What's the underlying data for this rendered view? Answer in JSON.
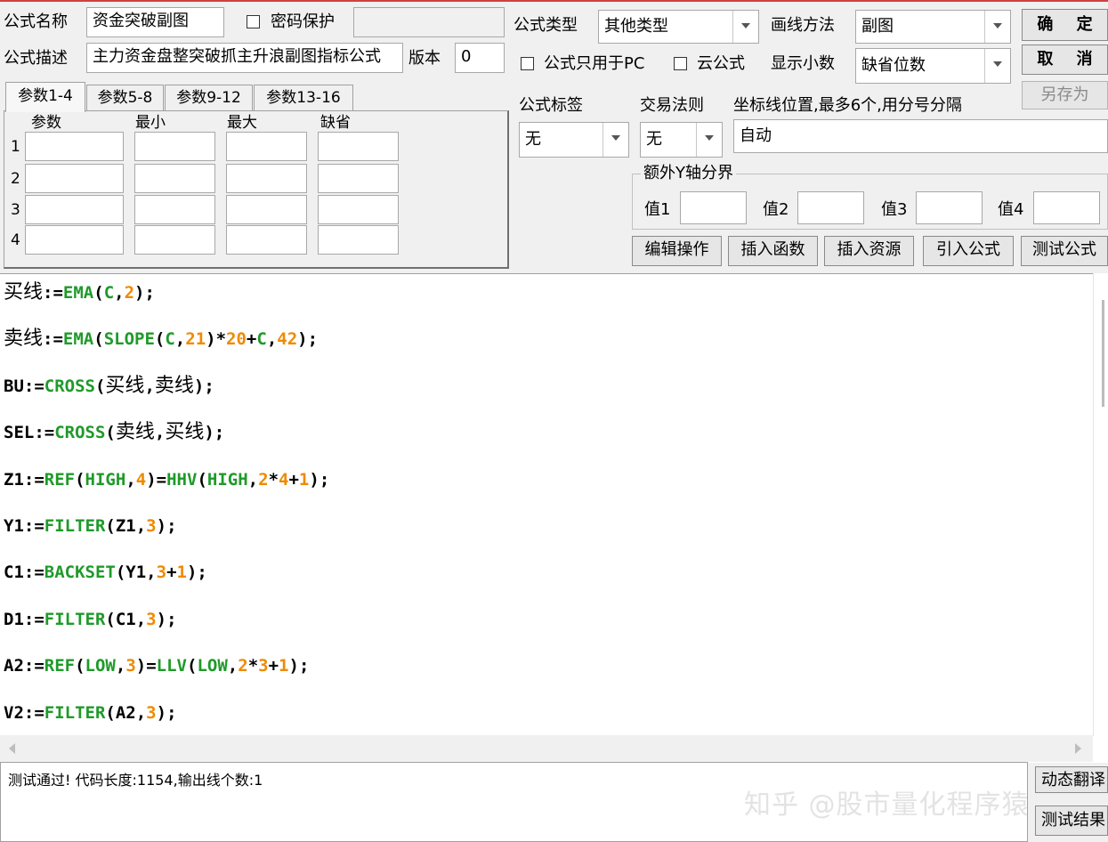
{
  "form": {
    "name_label": "公式名称",
    "name_value": "资金突破副图",
    "password_label": "密码保护",
    "password_value": "",
    "desc_label": "公式描述",
    "desc_value": "主力资金盘整突破抓主升浪副图指标公式",
    "version_label": "版本",
    "version_value": "0",
    "type_label": "公式类型",
    "type_value": "其他类型",
    "draw_label": "画线方法",
    "draw_value": "副图",
    "pc_only_label": "公式只用于PC",
    "cloud_label": "云公式",
    "decimal_label": "显示小数",
    "decimal_value": "缺省位数"
  },
  "buttons": {
    "ok": "确 定",
    "cancel": "取 消",
    "save_as": "另存为"
  },
  "tabs": [
    "参数1-4",
    "参数5-8",
    "参数9-12",
    "参数13-16"
  ],
  "params": {
    "headers": [
      "参数",
      "最小",
      "最大",
      "缺省"
    ],
    "rows": [
      "1",
      "2",
      "3",
      "4"
    ]
  },
  "tag": {
    "label": "公式标签",
    "value": "无"
  },
  "trade_rule": {
    "label": "交易法则",
    "value": "无"
  },
  "coord": {
    "label": "坐标线位置,最多6个,用分号分隔",
    "value": "自动"
  },
  "yaxis": {
    "title": "额外Y轴分界",
    "labels": [
      "值1",
      "值2",
      "值3",
      "值4"
    ]
  },
  "action_buttons": [
    "编辑操作",
    "插入函数",
    "插入资源",
    "引入公式",
    "测试公式"
  ],
  "code": [
    [
      [
        "cn",
        "买线"
      ],
      [
        "t",
        ":="
      ],
      [
        "f",
        "EMA"
      ],
      [
        "t",
        "("
      ],
      [
        "f",
        "C"
      ],
      [
        "t",
        ","
      ],
      [
        "n",
        "2"
      ],
      [
        "t",
        ");"
      ]
    ],
    [
      [
        "cn",
        "卖线"
      ],
      [
        "t",
        ":="
      ],
      [
        "f",
        "EMA"
      ],
      [
        "t",
        "("
      ],
      [
        "f",
        "SLOPE"
      ],
      [
        "t",
        "("
      ],
      [
        "f",
        "C"
      ],
      [
        "t",
        ","
      ],
      [
        "n",
        "21"
      ],
      [
        "t",
        ")*"
      ],
      [
        "n",
        "20"
      ],
      [
        "t",
        "+"
      ],
      [
        "f",
        "C"
      ],
      [
        "t",
        ","
      ],
      [
        "n",
        "42"
      ],
      [
        "t",
        ");"
      ]
    ],
    [
      [
        "t",
        "BU:="
      ],
      [
        "f",
        "CROSS"
      ],
      [
        "t",
        "("
      ],
      [
        "cn",
        "买线"
      ],
      [
        "t",
        ","
      ],
      [
        "cn",
        "卖线"
      ],
      [
        "t",
        ");"
      ]
    ],
    [
      [
        "t",
        "SEL:="
      ],
      [
        "f",
        "CROSS"
      ],
      [
        "t",
        "("
      ],
      [
        "cn",
        "卖线"
      ],
      [
        "t",
        ","
      ],
      [
        "cn",
        "买线"
      ],
      [
        "t",
        ");"
      ]
    ],
    [
      [
        "t",
        "Z1:="
      ],
      [
        "f",
        "REF"
      ],
      [
        "t",
        "("
      ],
      [
        "f",
        "HIGH"
      ],
      [
        "t",
        ","
      ],
      [
        "n",
        "4"
      ],
      [
        "t",
        ")="
      ],
      [
        "f",
        "HHV"
      ],
      [
        "t",
        "("
      ],
      [
        "f",
        "HIGH"
      ],
      [
        "t",
        ","
      ],
      [
        "n",
        "2"
      ],
      [
        "t",
        "*"
      ],
      [
        "n",
        "4"
      ],
      [
        "t",
        "+"
      ],
      [
        "n",
        "1"
      ],
      [
        "t",
        ");"
      ]
    ],
    [
      [
        "t",
        "Y1:="
      ],
      [
        "f",
        "FILTER"
      ],
      [
        "t",
        "(Z1,"
      ],
      [
        "n",
        "3"
      ],
      [
        "t",
        ");"
      ]
    ],
    [
      [
        "t",
        "C1:="
      ],
      [
        "f",
        "BACKSET"
      ],
      [
        "t",
        "(Y1,"
      ],
      [
        "n",
        "3"
      ],
      [
        "t",
        "+"
      ],
      [
        "n",
        "1"
      ],
      [
        "t",
        ");"
      ]
    ],
    [
      [
        "t",
        "D1:="
      ],
      [
        "f",
        "FILTER"
      ],
      [
        "t",
        "(C1,"
      ],
      [
        "n",
        "3"
      ],
      [
        "t",
        ");"
      ]
    ],
    [
      [
        "t",
        "A2:="
      ],
      [
        "f",
        "REF"
      ],
      [
        "t",
        "("
      ],
      [
        "f",
        "LOW"
      ],
      [
        "t",
        ","
      ],
      [
        "n",
        "3"
      ],
      [
        "t",
        ")="
      ],
      [
        "f",
        "LLV"
      ],
      [
        "t",
        "("
      ],
      [
        "f",
        "LOW"
      ],
      [
        "t",
        ","
      ],
      [
        "n",
        "2"
      ],
      [
        "t",
        "*"
      ],
      [
        "n",
        "3"
      ],
      [
        "t",
        "+"
      ],
      [
        "n",
        "1"
      ],
      [
        "t",
        ");"
      ]
    ],
    [
      [
        "t",
        "V2:="
      ],
      [
        "f",
        "FILTER"
      ],
      [
        "t",
        "(A2,"
      ],
      [
        "n",
        "3"
      ],
      [
        "t",
        ");"
      ]
    ]
  ],
  "output": {
    "text": "测试通过! 代码长度:1154,输出线个数:1"
  },
  "side_buttons": [
    "动态翻译",
    "测试结果"
  ],
  "watermark": "知乎 @股市量化程序猿",
  "colors": {
    "function": "#1f9a2a",
    "number": "#f08a00",
    "text": "#000000"
  }
}
